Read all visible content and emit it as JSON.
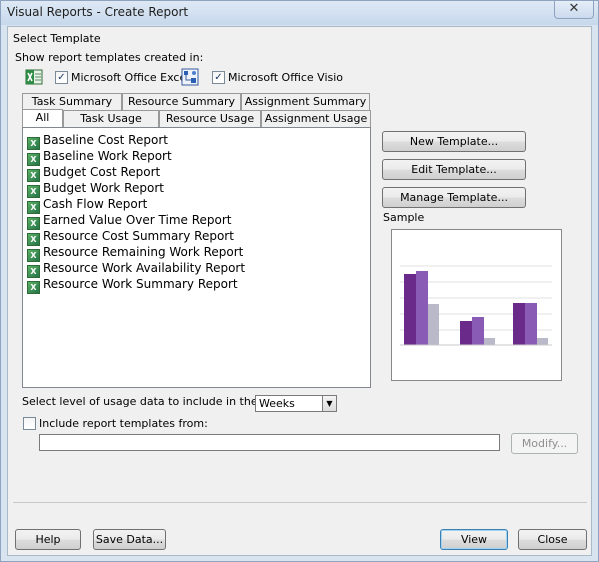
{
  "window": {
    "title": "Visual Reports - Create Report",
    "close_glyph": "✕"
  },
  "template_section": {
    "heading": "Select Template",
    "show_label": "Show report templates created in:",
    "excel_label": "Microsoft Office Excel",
    "excel_checked": true,
    "visio_label": "Microsoft Office Visio",
    "visio_checked": true
  },
  "tabs": {
    "back_row": [
      "Task Summary",
      "Resource Summary",
      "Assignment Summary"
    ],
    "front_row": [
      "All",
      "Task Usage",
      "Resource Usage",
      "Assignment Usage"
    ],
    "active": "All"
  },
  "reports": [
    "Baseline Cost Report",
    "Baseline Work Report",
    "Budget Cost Report",
    "Budget Work Report",
    "Cash Flow Report",
    "Earned Value Over Time Report",
    "Resource Cost Summary Report",
    "Resource Remaining Work Report",
    "Resource Work Availability Report",
    "Resource Work Summary Report"
  ],
  "side_buttons": {
    "new": "New Template...",
    "edit": "Edit Template...",
    "manage": "Manage Template..."
  },
  "sample": {
    "label": "Sample",
    "colors": {
      "dark": "#6a2a8a",
      "mid": "#8a5bb5",
      "light": "#b9b9c9"
    }
  },
  "usage": {
    "label": "Select level of usage data to include in the report:",
    "value": "Weeks",
    "arrow": "▼"
  },
  "include": {
    "label": "Include report templates from:",
    "checked": false,
    "path_value": "",
    "modify": "Modify..."
  },
  "footer": {
    "help": "Help",
    "save_data": "Save Data...",
    "view": "View",
    "close": "Close"
  },
  "check_glyph": "✓",
  "excel_icon_text": "X"
}
